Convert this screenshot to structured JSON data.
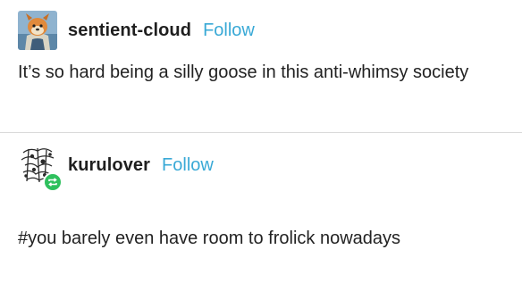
{
  "colors": {
    "follow": "#39a9d6",
    "reblog_badge": "#2ec05d",
    "divider": "#d9d9d9",
    "text": "#222222"
  },
  "posts": [
    {
      "username": "sentient-cloud",
      "follow_label": "Follow",
      "avatar_icon": "goose-character-avatar",
      "text": "It’s so hard being a silly goose in this anti-whimsy society"
    },
    {
      "username": "kurulover",
      "follow_label": "Follow",
      "avatar_icon": "sketch-avatar",
      "badge_icon": "reblog-icon",
      "text": "#you barely even have room to frolick nowadays"
    }
  ]
}
